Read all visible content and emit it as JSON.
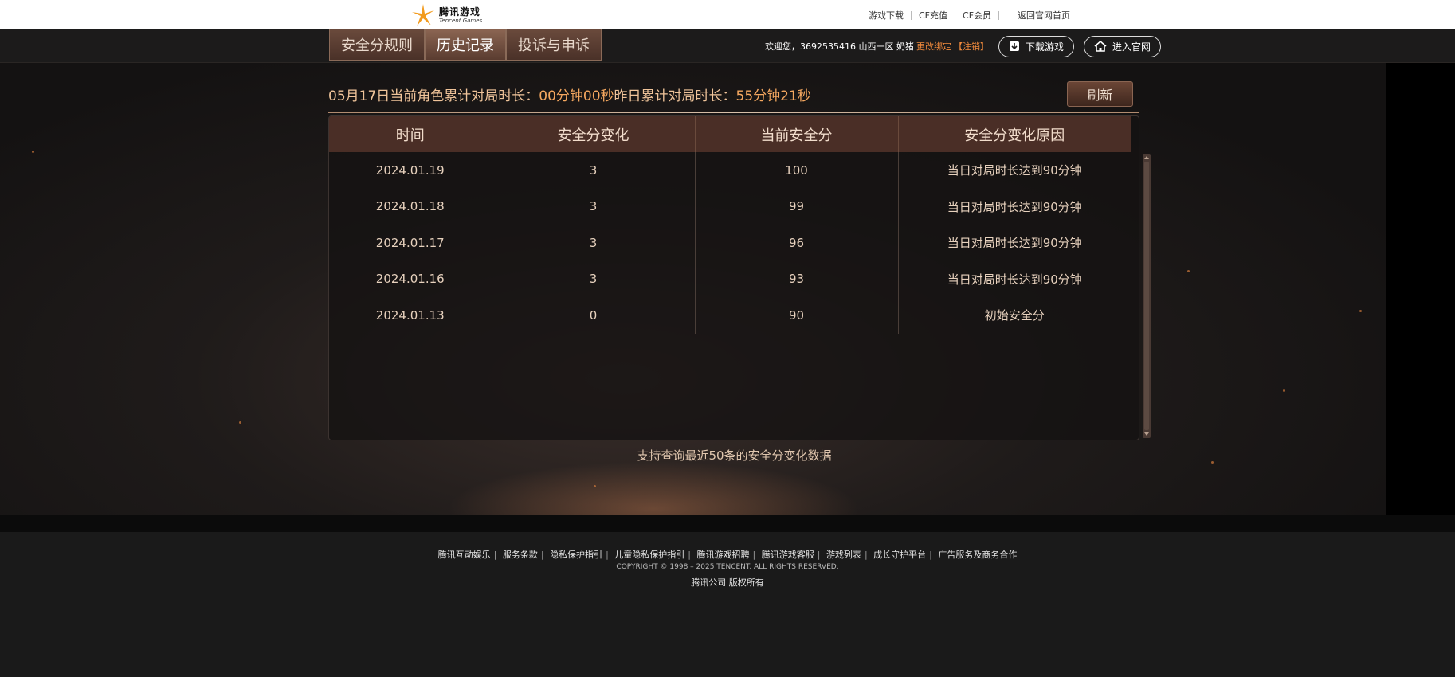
{
  "top": {
    "logo_cn": "腾讯游戏",
    "logo_en": "Tencent Games",
    "links": [
      "游戏下载",
      "CF充值",
      "CF会员",
      "返回官网首页"
    ]
  },
  "nav": {
    "tabs": [
      "安全分规则",
      "历史记录",
      "投诉与申诉"
    ],
    "active_tab": 1,
    "welcome": "欢迎您，3692535416 山西一区 奶猪",
    "change_bind": "更改绑定",
    "logout": "【注销】",
    "download_btn": "下载游戏",
    "official_btn": "进入官网"
  },
  "stats": {
    "today_label": "05月17日当前角色累计对局时长：",
    "today_value": "00分钟00秒",
    "yesterday_label": "昨日累计对局时长：",
    "yesterday_value": "55分钟21秒",
    "refresh": "刷新"
  },
  "table": {
    "headers": [
      "时间",
      "安全分变化",
      "当前安全分",
      "安全分变化原因"
    ],
    "rows": [
      [
        "2024.01.19",
        "3",
        "100",
        "当日对局时长达到90分钟"
      ],
      [
        "2024.01.18",
        "3",
        "99",
        "当日对局时长达到90分钟"
      ],
      [
        "2024.01.17",
        "3",
        "96",
        "当日对局时长达到90分钟"
      ],
      [
        "2024.01.16",
        "3",
        "93",
        "当日对局时长达到90分钟"
      ],
      [
        "2024.01.13",
        "0",
        "90",
        "初始安全分"
      ]
    ]
  },
  "note": "支持查询最近50条的安全分变化数据",
  "footer": {
    "links": [
      "腾讯互动娱乐",
      "服务条款",
      "隐私保护指引",
      "儿童隐私保护指引",
      "腾讯游戏招聘",
      "腾讯游戏客服",
      "游戏列表",
      "成长守护平台",
      "广告服务及商务合作"
    ],
    "copyright": "COPYRIGHT © 1998 – 2025 TENCENT. ALL RIGHTS RESERVED.",
    "company": "腾讯公司 版权所有"
  },
  "colors": {
    "accent": "#f5a860",
    "warning": "#f08a3c",
    "header_bg": "#4a2e26"
  }
}
